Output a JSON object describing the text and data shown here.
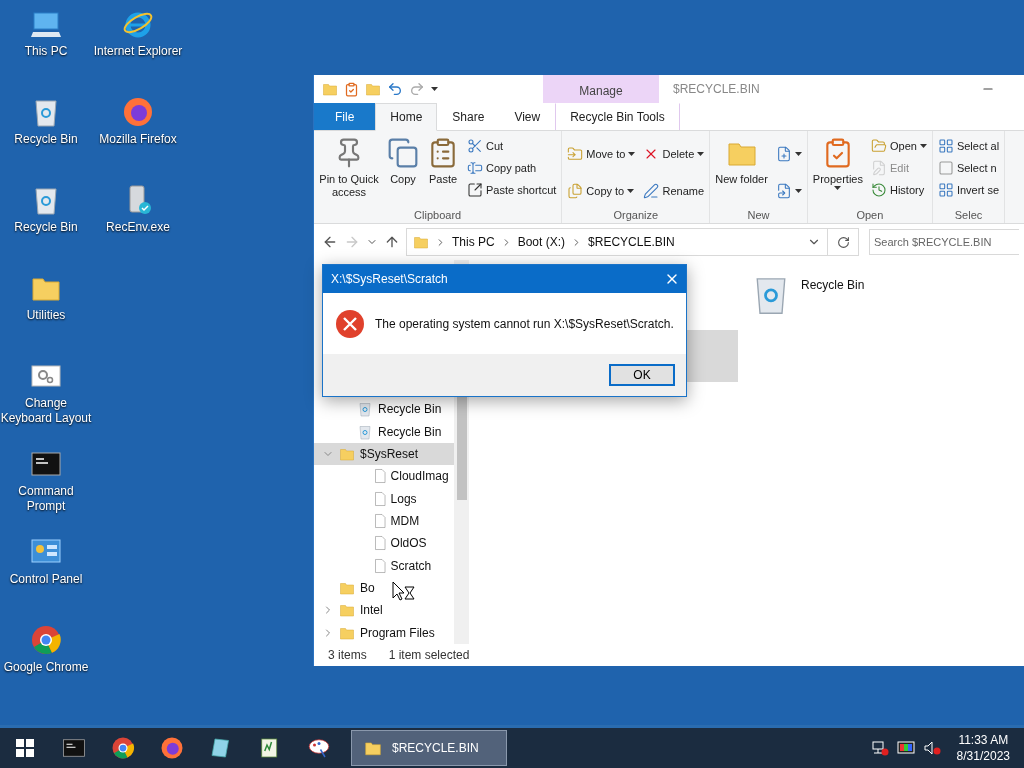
{
  "desktop_icons": [
    {
      "label": "This PC",
      "kind": "pc"
    },
    {
      "label": "Recycle Bin",
      "kind": "recycle"
    },
    {
      "label": "Recycle Bin",
      "kind": "recycle"
    },
    {
      "label": "Utilities",
      "kind": "folder"
    },
    {
      "label": "Change Keyboard Layout",
      "kind": "settings"
    },
    {
      "label": "Command Prompt",
      "kind": "console"
    },
    {
      "label": "Control Panel",
      "kind": "control"
    },
    {
      "label": "Google Chrome",
      "kind": "chrome"
    },
    {
      "label": "Internet Explorer",
      "kind": "ie"
    },
    {
      "label": "Mozilla Firefox",
      "kind": "firefox"
    },
    {
      "label": "RecEnv.exe",
      "kind": "exe"
    }
  ],
  "explorer": {
    "title": "$RECYCLE.BIN",
    "context_group": "Manage",
    "tabs": [
      {
        "label": "File",
        "kind": "file",
        "selected": false
      },
      {
        "label": "Home",
        "kind": "plain",
        "selected": true
      },
      {
        "label": "Share",
        "kind": "plain",
        "selected": false
      },
      {
        "label": "View",
        "kind": "plain",
        "selected": false
      },
      {
        "label": "Recycle Bin Tools",
        "kind": "context",
        "selected": false
      }
    ],
    "ribbon": [
      {
        "title": "Clipboard",
        "columns": [
          {
            "kind": "large",
            "buttons": [
              {
                "label": "Pin to Quick access",
                "kind": "pin",
                "dropdown": false,
                "disabled": false
              }
            ]
          },
          {
            "kind": "large",
            "buttons": [
              {
                "label": "Copy",
                "kind": "copy",
                "dropdown": false,
                "disabled": false
              }
            ]
          },
          {
            "kind": "large",
            "buttons": [
              {
                "label": "Paste",
                "kind": "paste",
                "dropdown": false,
                "disabled": false
              }
            ]
          },
          {
            "kind": "stack",
            "buttons": [
              {
                "label": "Cut",
                "kind": "cut",
                "dropdown": false,
                "disabled": false
              },
              {
                "label": "Copy path",
                "kind": "path",
                "dropdown": false,
                "disabled": false
              },
              {
                "label": "Paste shortcut",
                "kind": "shortcut",
                "dropdown": false,
                "disabled": false
              }
            ]
          }
        ]
      },
      {
        "title": "Organize",
        "columns": [
          {
            "kind": "pair",
            "buttons": [
              {
                "label": "Move to",
                "kind": "move",
                "dropdown": true,
                "disabled": false
              },
              {
                "label": "Copy to",
                "kind": "copyto",
                "dropdown": true,
                "disabled": false
              }
            ]
          },
          {
            "kind": "pair",
            "buttons": [
              {
                "label": "Delete",
                "kind": "delete",
                "dropdown": true,
                "disabled": false
              },
              {
                "label": "Rename",
                "kind": "rename",
                "dropdown": false,
                "disabled": false
              }
            ]
          }
        ]
      },
      {
        "title": "New",
        "columns": [
          {
            "kind": "large",
            "buttons": [
              {
                "label": "New folder",
                "kind": "newfolder",
                "dropdown": false,
                "disabled": false
              }
            ]
          },
          {
            "kind": "pair",
            "buttons": [
              {
                "kind": "newitem",
                "dropdown": true,
                "disabled": false
              },
              {
                "kind": "easyaccess",
                "dropdown": true,
                "disabled": false
              }
            ]
          }
        ]
      },
      {
        "title": "Open",
        "columns": [
          {
            "kind": "large",
            "buttons": [
              {
                "label": "Properties",
                "kind": "properties",
                "dropdown": true,
                "disabled": false
              }
            ]
          },
          {
            "kind": "stack",
            "buttons": [
              {
                "label": "Open",
                "kind": "open",
                "dropdown": true,
                "disabled": false
              },
              {
                "label": "Edit",
                "kind": "edit",
                "dropdown": false,
                "disabled": true
              },
              {
                "label": "History",
                "kind": "history",
                "dropdown": false,
                "disabled": false
              }
            ]
          }
        ]
      },
      {
        "title": "Selec",
        "columns": [
          {
            "kind": "stack",
            "buttons": [
              {
                "label": "Select al",
                "kind": "selectall",
                "dropdown": false,
                "disabled": false
              },
              {
                "label": "Select n",
                "kind": "selectnone",
                "dropdown": false,
                "disabled": false
              },
              {
                "label": "Invert se",
                "kind": "invert",
                "dropdown": false,
                "disabled": false
              }
            ]
          }
        ]
      }
    ],
    "address": {
      "back_disabled": false,
      "forward_disabled": true,
      "crumbs": [
        "This PC",
        "Boot (X:)",
        "$RECYCLE.BIN"
      ],
      "search_placeholder": "Search $RECYCLE.BIN"
    },
    "tree": [
      {
        "label": "Recycle Bin",
        "kind": "recycle",
        "selected": false
      },
      {
        "label": "Recycle Bin",
        "kind": "recycle",
        "selected": false
      },
      {
        "label": "$SysReset",
        "kind": "folder",
        "selected": true,
        "expanded": true,
        "children": [
          {
            "label": "CloudImag",
            "kind": "file",
            "selected": false
          },
          {
            "label": "Logs",
            "kind": "file",
            "selected": false
          },
          {
            "label": "MDM",
            "kind": "file",
            "selected": false
          },
          {
            "label": "OldOS",
            "kind": "file",
            "selected": false
          },
          {
            "label": "Scratch",
            "kind": "file",
            "selected": false
          }
        ]
      },
      {
        "label": "Bo",
        "kind": "folder",
        "selected": false
      },
      {
        "label": "Intel",
        "kind": "folder",
        "selected": false,
        "expanded": false
      },
      {
        "label": "Program Files",
        "kind": "folder",
        "selected": false,
        "expanded": false
      }
    ],
    "items": [
      {
        "label": "Recycle Bin",
        "kind": "recycle"
      }
    ],
    "status": [
      "3 items",
      "1 item selected"
    ]
  },
  "dialog": {
    "title": "X:\\$SysReset\\Scratch",
    "message": "The operating system cannot run X:\\$SysReset\\Scratch.",
    "button": "OK"
  },
  "taskbar": {
    "apps": [
      {
        "kind": "console",
        "selected": false
      },
      {
        "kind": "chrome",
        "selected": false
      },
      {
        "kind": "firefox",
        "selected": false
      },
      {
        "kind": "glass",
        "selected": false
      },
      {
        "kind": "notepad",
        "selected": false
      },
      {
        "kind": "paint",
        "selected": false
      },
      {
        "kind": "folder",
        "label": "$RECYCLE.BIN",
        "selected": true
      }
    ],
    "time": "11:33 AM",
    "date": "8/31/2023"
  }
}
